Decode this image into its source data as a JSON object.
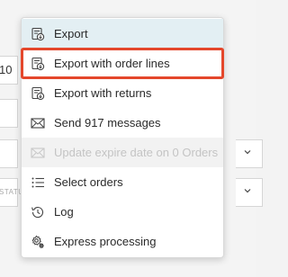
{
  "background": {
    "number_value": "10",
    "status_placeholder": "STATUS"
  },
  "menu": {
    "items": [
      {
        "label": "Export",
        "icon": "export-icon",
        "state": "hover"
      },
      {
        "label": "Export with order lines",
        "icon": "export-icon",
        "state": "highlighted"
      },
      {
        "label": "Export with returns",
        "icon": "export-icon",
        "state": "normal"
      },
      {
        "label": "Send 917 messages",
        "icon": "envelope-icon",
        "state": "normal"
      },
      {
        "label": "Update expire date on 0 Orders",
        "icon": "envelope-icon",
        "state": "disabled"
      },
      {
        "label": "Select orders",
        "icon": "list-icon",
        "state": "normal"
      },
      {
        "label": "Log",
        "icon": "history-icon",
        "state": "normal"
      },
      {
        "label": "Express processing",
        "icon": "gear-icon",
        "state": "normal"
      }
    ]
  },
  "colors": {
    "hover_bg": "#e3eff3",
    "highlight_border": "#e4472b",
    "disabled_text": "#c4c4c4"
  }
}
